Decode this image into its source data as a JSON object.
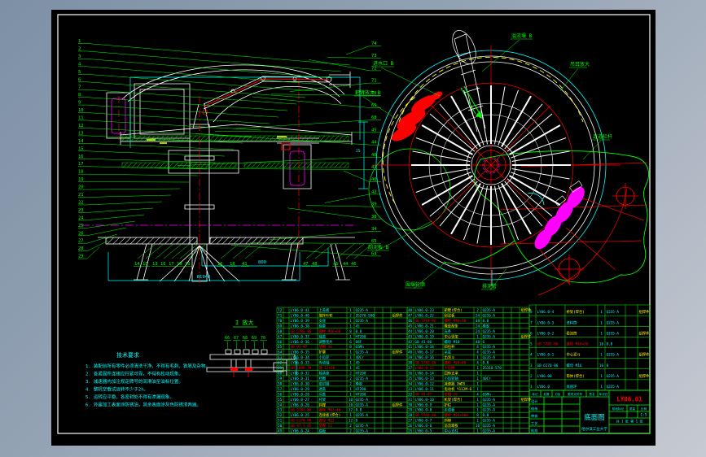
{
  "app": {
    "background_outer": "#8295a9",
    "paper": "#000000",
    "frame": "#ffffff"
  },
  "palette": {
    "green": "#00ff00",
    "cyan": "#00ffff",
    "red": "#ff0000",
    "magenta": "#ff00ff",
    "yellow": "#ffff00",
    "white": "#ffffff"
  },
  "left_view": {
    "callouts_left": [
      "1",
      "2",
      "3",
      "4",
      "5",
      "6",
      "7",
      "8",
      "9",
      "10",
      "11",
      "12",
      "13",
      "14",
      "15",
      "16",
      "17",
      "18",
      "19",
      "20",
      "21",
      "22",
      "23",
      "24",
      "25",
      "26",
      "27",
      "28",
      "29"
    ],
    "callouts_right": [
      "74",
      "73",
      "72",
      "71",
      "70",
      "69",
      "68",
      "45",
      "44",
      "46",
      "47",
      "40",
      "42",
      "39",
      "38",
      "34",
      "65",
      "64"
    ],
    "callouts_bottom": [
      "14",
      "15",
      "13",
      "16",
      "17",
      "18",
      "19",
      "16",
      "18",
      "41",
      "47",
      "48",
      "45",
      "44",
      "46"
    ],
    "dim_width": "800",
    "dim_total": "Ø1940",
    "dim_side": "25"
  },
  "right_view": {
    "labels": [
      "溢流堰 B",
      "进水口 B",
      "耙臂放大 B",
      "刮泥板 B",
      "围堰轮廓",
      "排泥管",
      "吊耳放大",
      "走道栏杆"
    ]
  },
  "detail": {
    "label": "I 放大",
    "callouts": [
      "66",
      "67",
      "68",
      "69",
      "70"
    ]
  },
  "notes": {
    "title": "技术要求",
    "lines": [
      "1. 装配前所有零件必须清洗干净，不得有毛刺、铁屑及杂物。",
      "2. 各紧固件连接应拧紧可靠，不得有松动现象。",
      "3. 减速器内加注规定牌号的润滑油至油标位置。",
      "4. 整机空载试运转不少于2h。",
      "5. 运转应平稳，各密封处不得有渗漏现象。",
      "6. 外露加工表面涂防锈油，其余表面涂灰色防锈漆两遍。"
    ]
  },
  "bom": {
    "left_rows": [
      [
        "72",
        "LY06.0-41",
        "上盖板",
        "1",
        "Q235-A",
        "",
        ""
      ],
      [
        "71",
        "LY06.0-40",
        "搅拌叶轮",
        "2",
        "ZG270-500",
        "组焊件",
        "y"
      ],
      [
        "70",
        "LY06.0-39",
        "支座",
        "1",
        "Q235-A",
        "",
        ""
      ],
      [
        "69",
        "LY06.0-38",
        "轴套",
        "1",
        "45",
        "",
        ""
      ],
      [
        "68",
        "GB 5782-86",
        "螺栓 M16×60",
        "8",
        "8.8",
        "",
        "r"
      ],
      [
        "67",
        "LY06.0-37",
        "端盖",
        "1",
        "HT200",
        "",
        ""
      ],
      [
        "66",
        "LY06.0-36",
        "调整垫片",
        "6",
        "08F",
        "",
        ""
      ],
      [
        "65",
        "GB 93-87",
        "垫圈 16",
        "8",
        "65Mn",
        "",
        "r"
      ],
      [
        "64",
        "LY06.0-35",
        "护罩",
        "1",
        "Q235-A",
        "组焊件",
        "y"
      ],
      [
        "63",
        "LY06.0-34",
        "小齿轮",
        "1",
        "40Cr",
        "",
        ""
      ],
      [
        "62",
        "LY06.0-33",
        "传动轴",
        "1",
        "45",
        "",
        ""
      ],
      [
        "61",
        "GB 1096-79",
        "键 12×56",
        "1",
        "45",
        "",
        "r"
      ],
      [
        "60",
        "LY06.0-32",
        "轴承座",
        "2",
        "HT200",
        "",
        ""
      ],
      [
        "59",
        "LY06.0-31",
        "挡圈",
        "2",
        "Q235-A",
        "",
        ""
      ],
      [
        "58",
        "LY06.0-30",
        "密封圈",
        "2",
        "橡胶",
        "",
        ""
      ],
      [
        "57",
        "LY06.0-29",
        "透盖",
        "1",
        "HT200",
        "",
        ""
      ],
      [
        "56",
        "LY06.0-28",
        "闷盖",
        "1",
        "HT200",
        "",
        ""
      ],
      [
        "55",
        "LY06.0-27",
        "托架",
        "10",
        "Q235-A",
        "",
        ""
      ],
      [
        "54",
        "LY06.0-26",
        "斜撑",
        "10",
        "Q235-A",
        "组焊件",
        "y"
      ],
      [
        "53",
        "GB 5782-86",
        "螺栓 M12×40",
        "12",
        "8.8",
        "",
        "r"
      ],
      [
        "52",
        "LY06.0-25",
        "连接板(焊合)",
        "1",
        "Q235-A",
        "",
        "y"
      ],
      [
        "51",
        "GB 6170-86",
        "螺母 M12",
        "12",
        "8",
        "",
        "r"
      ],
      [
        "50",
        "GB 97.1-85",
        "垫圈 12",
        "2",
        "Q235-A",
        "",
        "r"
      ],
      [
        "49",
        "LY06.0-24",
        "底板",
        "2",
        "Q235-A",
        "",
        ""
      ]
    ],
    "mid_rows": [
      [
        "48",
        "LY06.0-23",
        "耙臂(焊合)",
        "2",
        "Q235-A",
        "组焊件",
        "y"
      ],
      [
        "47",
        "LY06.0-22",
        "刮泥板",
        "24",
        "Q235-A",
        "",
        "y"
      ],
      [
        "46",
        "GB 5783-86",
        "螺栓 M10×30",
        "48",
        "8.8",
        "",
        "r"
      ],
      [
        "45",
        "LY06.0-21",
        "橡胶刮条",
        "24",
        "橡胶",
        "",
        "y"
      ],
      [
        "44",
        "LY06.0-20",
        "压条",
        "24",
        "Q235-A",
        "",
        ""
      ],
      [
        "43",
        "LY06.0-19",
        "中心竖架",
        "1",
        "Q235-A",
        "组焊件",
        "y"
      ],
      [
        "42",
        "GB 41-86",
        "螺母 M10",
        "48",
        "6",
        "",
        ""
      ],
      [
        "41",
        "LY06.0-18",
        "斜拉杆",
        "4",
        "Q235-A",
        "",
        "y"
      ],
      [
        "40",
        "LY06.0-17",
        "吊耳",
        "4",
        "Q235-A",
        "",
        ""
      ],
      [
        "39",
        "LY06.0-16",
        "出泥斗",
        "1",
        "Q235-A",
        "",
        "y"
      ],
      [
        "38",
        "GB 5782-86",
        "螺栓 M20×80",
        "4",
        "8.8",
        "",
        "r"
      ],
      [
        "37",
        "LY06.0-15",
        "大齿圈",
        "1",
        "ZG310-570",
        "",
        "r"
      ],
      [
        "36",
        "LY06.0-14",
        "回转支承",
        "1",
        "",
        "",
        "y"
      ],
      [
        "35",
        "LY06.0-13",
        "小齿轮轴",
        "1",
        "40Cr",
        "",
        ""
      ],
      [
        "34",
        "LY06.0-12",
        "减速器 XWD5",
        "1",
        "",
        "",
        "y"
      ],
      [
        "33",
        "LY06.0-11",
        "电动机 Y112M-6",
        "1",
        "",
        "",
        "y"
      ],
      [
        "32",
        "GB 93-87",
        "垫圈 20",
        "4",
        "65Mn",
        "",
        "r"
      ],
      [
        "31",
        "LY06.0-10",
        "机架(焊合)",
        "1",
        "Q235-A",
        "组焊件",
        "y"
      ],
      [
        "30",
        "LY06.0-9",
        "护栏",
        "1",
        "Q235-A",
        "",
        "y"
      ],
      [
        "29",
        "LY06.0-8",
        "走道板",
        "1",
        "Q235-A",
        "",
        ""
      ],
      [
        "28",
        "GB 5782-86",
        "螺栓 M24×100",
        "8",
        "8.8",
        "",
        "r"
      ],
      [
        "27",
        "LY06.0-7",
        "斜梯",
        "1",
        "Q235-A",
        "",
        "y"
      ],
      [
        "26",
        "LY06.0-6",
        "溢流堰板",
        "16",
        "Q235-A",
        "",
        "y"
      ],
      [
        "25",
        "LY06.0-5",
        "中心支柱",
        "1",
        "Q235-A",
        "",
        ""
      ]
    ],
    "right_rows": [
      [
        "8",
        "LY06.0-4",
        "桥架(焊合)",
        "1",
        "Q235-A",
        "组焊件",
        "y"
      ],
      [
        "7",
        "LY06.0-3",
        "进料筒",
        "1",
        "Q235-A",
        "",
        ""
      ],
      [
        "6",
        "LY06.0-2",
        "稳流筒",
        "1",
        "Q235-A",
        "组焊件",
        "y"
      ],
      [
        "5",
        "GB 5782-86",
        "螺栓 M16×50",
        "16",
        "8.8",
        "",
        "r"
      ],
      [
        "4",
        "LY06.0-1",
        "中心泥斗",
        "1",
        "Q235-A",
        "组焊件",
        "y"
      ],
      [
        "3",
        "GB 6170-86",
        "螺母 M16",
        "16",
        "8",
        "",
        ""
      ],
      [
        "2",
        "LY06.00",
        "筒体(焊合)",
        "1",
        "Q235-A",
        "组焊件",
        "y"
      ],
      [
        "1",
        "LY06.0",
        "底座环",
        "1",
        "Q235-A",
        "",
        ""
      ]
    ]
  },
  "titleblock": {
    "drawing_no": "LY06.01",
    "title": "底面图",
    "org": "哈尔滨工业大学",
    "top_cells": [
      "标记",
      "处数",
      "分区",
      "更改文件号",
      "签名",
      "年月日"
    ],
    "sig_rows": [
      "设计",
      "校核",
      "审核",
      "工艺",
      "批准"
    ],
    "right_cells": [
      "阶段标记",
      "质量",
      "比例"
    ],
    "scale": "1:5",
    "sheet": "共 1 张 第 1 张"
  }
}
